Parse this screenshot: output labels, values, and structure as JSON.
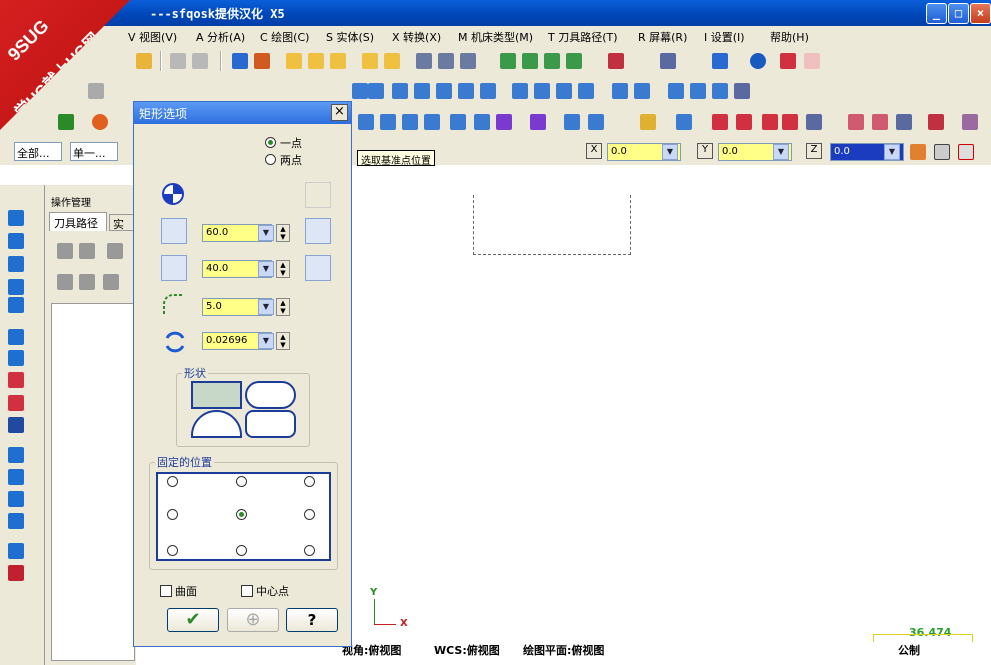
{
  "window": {
    "title": "---sfqosk提供汉化 X5",
    "minimize_icon": "minimize-icon",
    "maximize_icon": "maximize-icon",
    "close_icon": "close-icon"
  },
  "watermark": {
    "line1": "9SUG",
    "line2": "学UG就上UG网"
  },
  "menu": [
    "V 视图(V)",
    "A 分析(A)",
    "C 绘图(C)",
    "S 实体(S)",
    "X 转换(X)",
    "M 机床类型(M)",
    "T 刀具路径(T)",
    "R 屏幕(R)",
    "I 设置(I)",
    "帮助(H)"
  ],
  "selection_bar": {
    "level_value": "全部...",
    "mode_value": "单一...",
    "tooltip": "选取基准点位置"
  },
  "coords": {
    "x_label": "X",
    "x_value": "0.0",
    "y_label": "Y",
    "y_value": "0.0",
    "z_label": "Z",
    "z_value": "0.0"
  },
  "op_manager": {
    "title": "操作管理",
    "tab_toolpaths": "刀具路径",
    "tab_solids": "实体"
  },
  "dialog": {
    "title": "矩形选项",
    "one_point": "一点",
    "two_points": "两点",
    "width_value": "60.0",
    "height_value": "40.0",
    "fillet_value": "5.0",
    "rotation_value": "0.02696",
    "shape_label": "形状",
    "anchor_label": "固定的位置",
    "surface_label": "曲面",
    "center_label": "中心点"
  },
  "statusbar": {
    "view": "视角:俯视图",
    "wcs": "WCS:俯视图",
    "cplane": "绘图平面:俯视图",
    "scale_value": "36.474",
    "units": "公制"
  },
  "axes": {
    "y": "Y",
    "x": "X"
  },
  "colors": {
    "accent": "#0a5fd8",
    "field": "#ffff88",
    "dialog_bg": "#ece9d8"
  }
}
